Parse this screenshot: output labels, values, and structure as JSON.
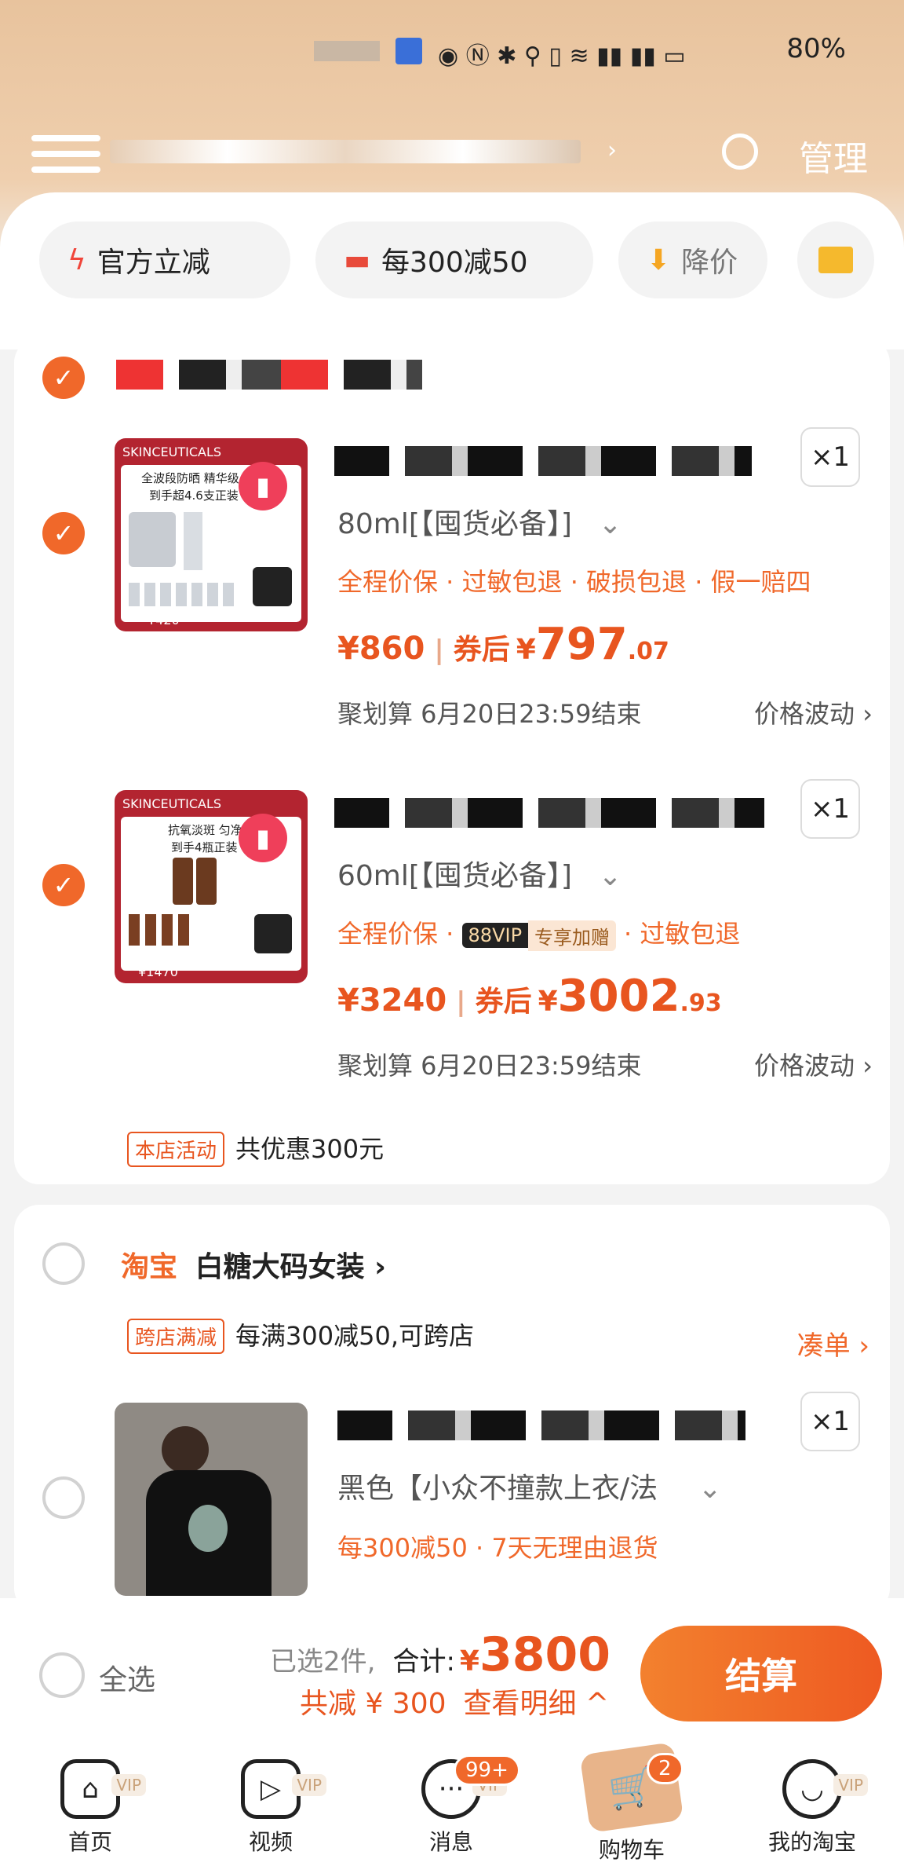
{
  "status_bar": {
    "battery": "80%"
  },
  "header": {
    "manage_label": "管理"
  },
  "filters": [
    {
      "label": "官方立减",
      "icon": "lightning-icon"
    },
    {
      "label": "每300减50",
      "icon": "coupon-icon"
    },
    {
      "label": "降价",
      "icon": "price-drop-icon"
    }
  ],
  "shop1": {
    "items": [
      {
        "spec": "80ml[【囤货必备】]",
        "tags": "全程价保 · 过敏包退 · 破损包退 · 假一赔四",
        "price": "¥860",
        "after_label": "券后",
        "after_currency": "¥",
        "after_int": "797",
        "after_dec": ".07",
        "meta": "聚划算 6月20日23:59结束",
        "wave": "价格波动 ›",
        "qty": "×1",
        "thumb": {
          "brand": "SKINCEUTICALS",
          "line1": "全波段防晒 精华级",
          "line2": "到手超4.6支正装",
          "price": "¥420"
        }
      },
      {
        "spec": "60ml[【囤货必备】]",
        "tags_pre": "全程价保 · ",
        "vip": "88VIP",
        "vip_desc": "专享加赠",
        "tags_post": "· 过敏包退",
        "price": "¥3240",
        "after_label": "券后",
        "after_currency": "¥",
        "after_int": "3002",
        "after_dec": ".93",
        "meta": "聚划算 6月20日23:59结束",
        "wave": "价格波动 ›",
        "qty": "×1",
        "thumb": {
          "brand": "SKINCEUTICALS",
          "line1": "抗氧淡斑 匀净透",
          "line2": "到手4瓶正装",
          "price": "¥1470"
        }
      }
    ],
    "activity_tag": "本店活动",
    "activity_text": "共优惠300元"
  },
  "shop2": {
    "platform": "淘宝",
    "name": "白糖大码女装 ›",
    "promo_tag": "跨店满减",
    "promo_text": "每满300减50,可跨店",
    "collect": "凑单 ›",
    "item": {
      "spec": "黑色【小众不撞款上衣/法",
      "tags": "每300减50 · 7天无理由退货",
      "qty": "×1"
    }
  },
  "checkout": {
    "select_all": "全选",
    "selected": "已选2件,",
    "total_label": "合计:",
    "currency": "¥",
    "total": "3800",
    "discount": "共减 ¥ 300",
    "detail": "查看明细 ^",
    "button": "结算"
  },
  "nav": [
    {
      "label": "首页",
      "icon": "home-icon"
    },
    {
      "label": "视频",
      "icon": "video-icon"
    },
    {
      "label": "消息",
      "icon": "message-icon",
      "badge": "99+"
    },
    {
      "label": "购物车",
      "icon": "cart-icon",
      "badge": "2"
    },
    {
      "label": "我的淘宝",
      "icon": "profile-icon"
    }
  ],
  "nav_vip": "VIP",
  "colors": {
    "accent": "#f0682a",
    "price": "#e8551f"
  }
}
